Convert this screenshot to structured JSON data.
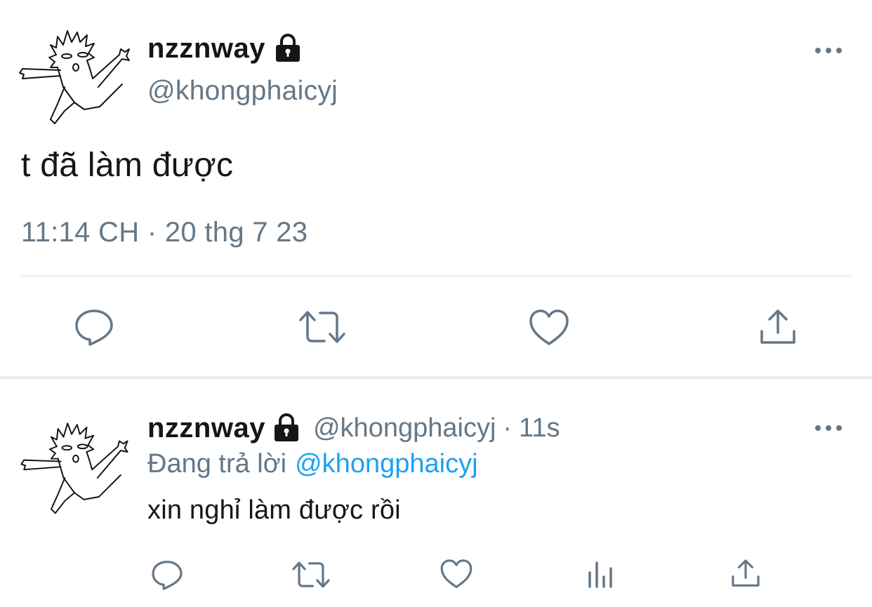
{
  "main_tweet": {
    "display_name": "nzznway",
    "handle": "@khongphaicyj",
    "text": "t đã làm được",
    "timestamp": "11:14 CH · 20 thg 7 23",
    "actions": [
      "reply-icon",
      "retweet-icon",
      "like-icon",
      "share-icon"
    ]
  },
  "reply_tweet": {
    "display_name": "nzznway",
    "handle": "@khongphaicyj",
    "separator": "·",
    "time": "11s",
    "replying_label": "Đang trả lời",
    "replying_target": "@khongphaicyj",
    "text": "xin nghỉ làm được rồi",
    "actions": [
      "reply-icon",
      "retweet-icon",
      "like-icon",
      "analytics-icon",
      "share-icon"
    ]
  },
  "colors": {
    "text_primary": "#14171a",
    "text_secondary": "#657786",
    "link": "#1da1f2",
    "divider": "#e6ecf0",
    "icon": "#657786"
  }
}
